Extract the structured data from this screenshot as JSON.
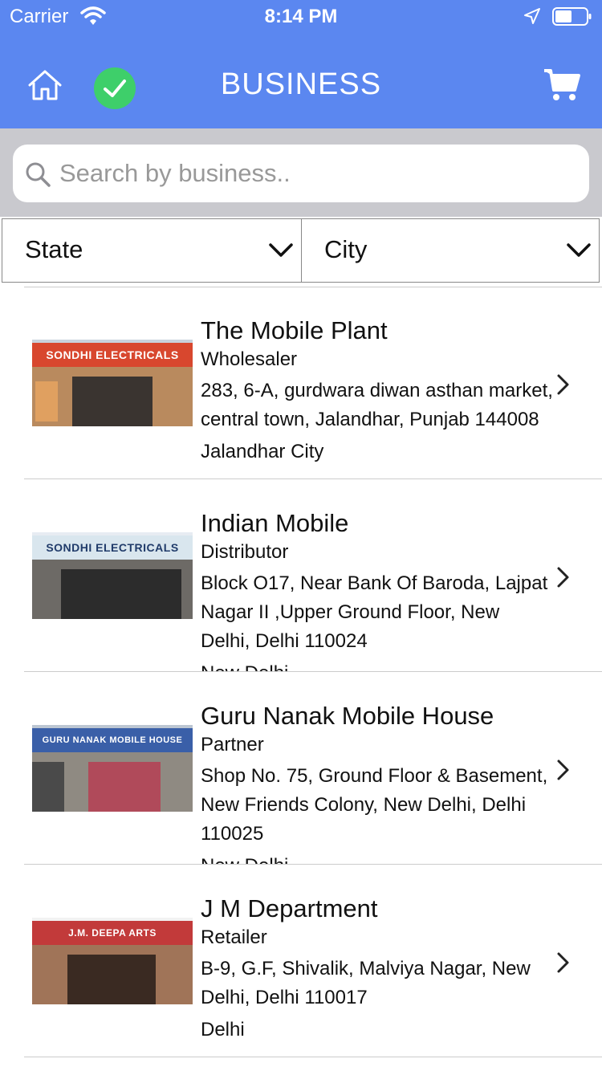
{
  "status_bar": {
    "carrier": "Carrier",
    "time": "8:14 PM"
  },
  "nav": {
    "title": "BUSINESS"
  },
  "search": {
    "placeholder": "Search by business.."
  },
  "filters": {
    "state_label": "State",
    "city_label": "City"
  },
  "colors": {
    "header": "#5b87f0",
    "check_badge": "#3ecf6a",
    "search_bar_bg": "#c9c9ce"
  },
  "businesses": [
    {
      "name": "The Mobile Plant",
      "type": "Wholesaler",
      "address": "283, 6-A, gurdwara diwan asthan market, central town, Jalandhar, Punjab 144008",
      "city": "Jalandhar City",
      "image_sign": "SONDHI ELECTRICALS"
    },
    {
      "name": "Indian Mobile",
      "type": "Distributor",
      "address": "Block O17, Near Bank Of Baroda, Lajpat Nagar II ,Upper Ground Floor, New Delhi, Delhi 110024",
      "city": "New Delhi",
      "image_sign": "SONDHI ELECTRICALS"
    },
    {
      "name": "Guru Nanak Mobile House",
      "type": "Partner",
      "address": "Shop No. 75, Ground Floor & Basement, New Friends Colony, New Delhi, Delhi 110025",
      "city": "New Delhi",
      "image_sign": "GURU NANAK MOBILE HOUSE"
    },
    {
      "name": "J M Department",
      "type": "Retailer",
      "address": " B-9, G.F, Shivalik, Malviya Nagar, New Delhi, Delhi 110017",
      "city": "Delhi",
      "image_sign": "J.M. DEEPA ARTS"
    }
  ]
}
